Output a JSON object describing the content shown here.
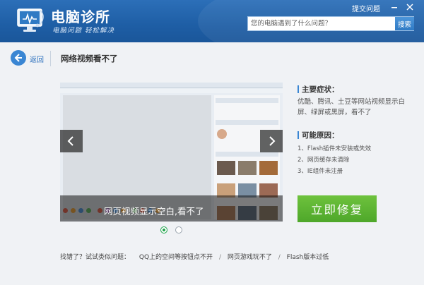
{
  "header": {
    "app_title": "电脑诊所",
    "slogan": "电脑问题 轻松解决",
    "feedback": "提交问题",
    "search_placeholder": "您的电脑遇到了什么问题？",
    "search_button": "搜索",
    "icons": {
      "logo": "monitor-stethoscope-icon",
      "minimize": "minimize-icon",
      "close": "close-icon"
    }
  },
  "nav": {
    "back_label": "返回",
    "back_icon": "arrow-left-icon",
    "page_title": "网络视频看不了"
  },
  "carousel": {
    "caption": "网页视频显示空白,看不了",
    "prev_icon": "chevron-left-icon",
    "next_icon": "chevron-right-icon",
    "slide_count": 2,
    "active_index": 0
  },
  "symptoms": {
    "title": "主要症状：",
    "text": "优酷、腾讯、土豆等网站视频显示白屏、绿屏或黑屏，看不了"
  },
  "causes": {
    "title": "可能原因：",
    "items": [
      "1、Flash插件未安装或失效",
      "2、网页缓存未清除",
      "3、IE组件未注册"
    ]
  },
  "fix_button": "立即修复",
  "footer": {
    "prompt": "找错了？试试类似问题：",
    "links": [
      "QQ上的空间等按钮点不开",
      "网页游戏玩不了",
      "Flash版本过低"
    ],
    "separator": "/"
  },
  "colors": {
    "header": "#1e5ea5",
    "accent": "#3a86d3",
    "fix_button": "#5cb531",
    "active_dot": "#1ea34a"
  }
}
